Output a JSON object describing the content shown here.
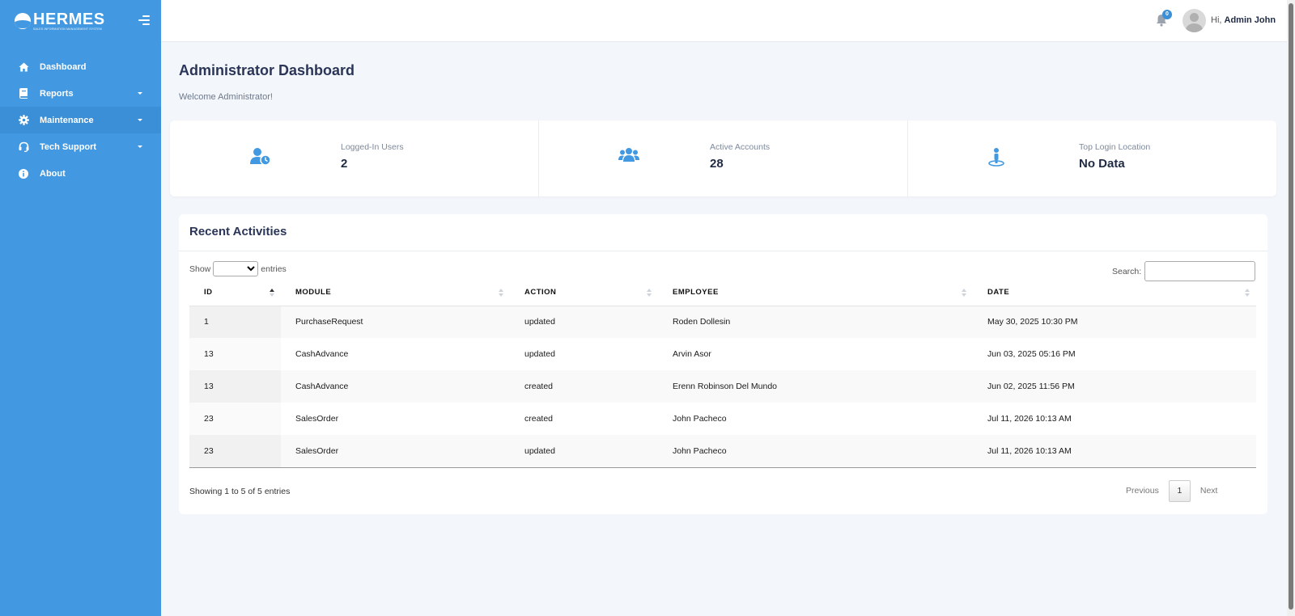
{
  "brand": {
    "name": "HERMES",
    "tagline": "SALES INFORMATION MANAGEMENT SYSTEM"
  },
  "sidebar": {
    "items": [
      {
        "label": "Dashboard",
        "icon": "home-icon",
        "has_caret": false
      },
      {
        "label": "Reports",
        "icon": "book-icon",
        "has_caret": true
      },
      {
        "label": "Maintenance",
        "icon": "gear-icon",
        "has_caret": true
      },
      {
        "label": "Tech Support",
        "icon": "headset-icon",
        "has_caret": true
      },
      {
        "label": "About",
        "icon": "info-icon",
        "has_caret": false
      }
    ]
  },
  "topbar": {
    "notification_count": "0",
    "greeting_prefix": "Hi,",
    "user_name": "Admin John"
  },
  "page": {
    "title": "Administrator Dashboard",
    "welcome": "Welcome Administrator!"
  },
  "stats": [
    {
      "label": "Logged-In Users",
      "value": "2",
      "icon": "user-clock-icon"
    },
    {
      "label": "Active Accounts",
      "value": "28",
      "icon": "users-icon"
    },
    {
      "label": "Top Login Location",
      "value": "No Data",
      "icon": "location-person-icon"
    }
  ],
  "activities": {
    "title": "Recent Activities",
    "show_label": "Show",
    "entries_label": "entries",
    "search_label": "Search:",
    "columns": [
      "ID",
      "MODULE",
      "ACTION",
      "EMPLOYEE",
      "DATE"
    ],
    "rows": [
      [
        "1",
        "PurchaseRequest",
        "updated",
        "Roden Dollesin",
        "May 30, 2025 10:30 PM"
      ],
      [
        "13",
        "CashAdvance",
        "updated",
        "Arvin Asor",
        "Jun 03, 2025 05:16 PM"
      ],
      [
        "13",
        "CashAdvance",
        "created",
        "Erenn Robinson Del Mundo",
        "Jun 02, 2025 11:56 PM"
      ],
      [
        "23",
        "SalesOrder",
        "created",
        "John Pacheco",
        "Jul 11, 2026 10:13 AM"
      ],
      [
        "23",
        "SalesOrder",
        "updated",
        "John Pacheco",
        "Jul 11, 2026 10:13 AM"
      ]
    ],
    "info": "Showing 1 to 5 of 5 entries",
    "pager": {
      "previous": "Previous",
      "page": "1",
      "next": "Next"
    }
  },
  "colors": {
    "sidebar": "#4299e1",
    "accent": "#3b8fd6",
    "background": "#f3f6fb"
  }
}
